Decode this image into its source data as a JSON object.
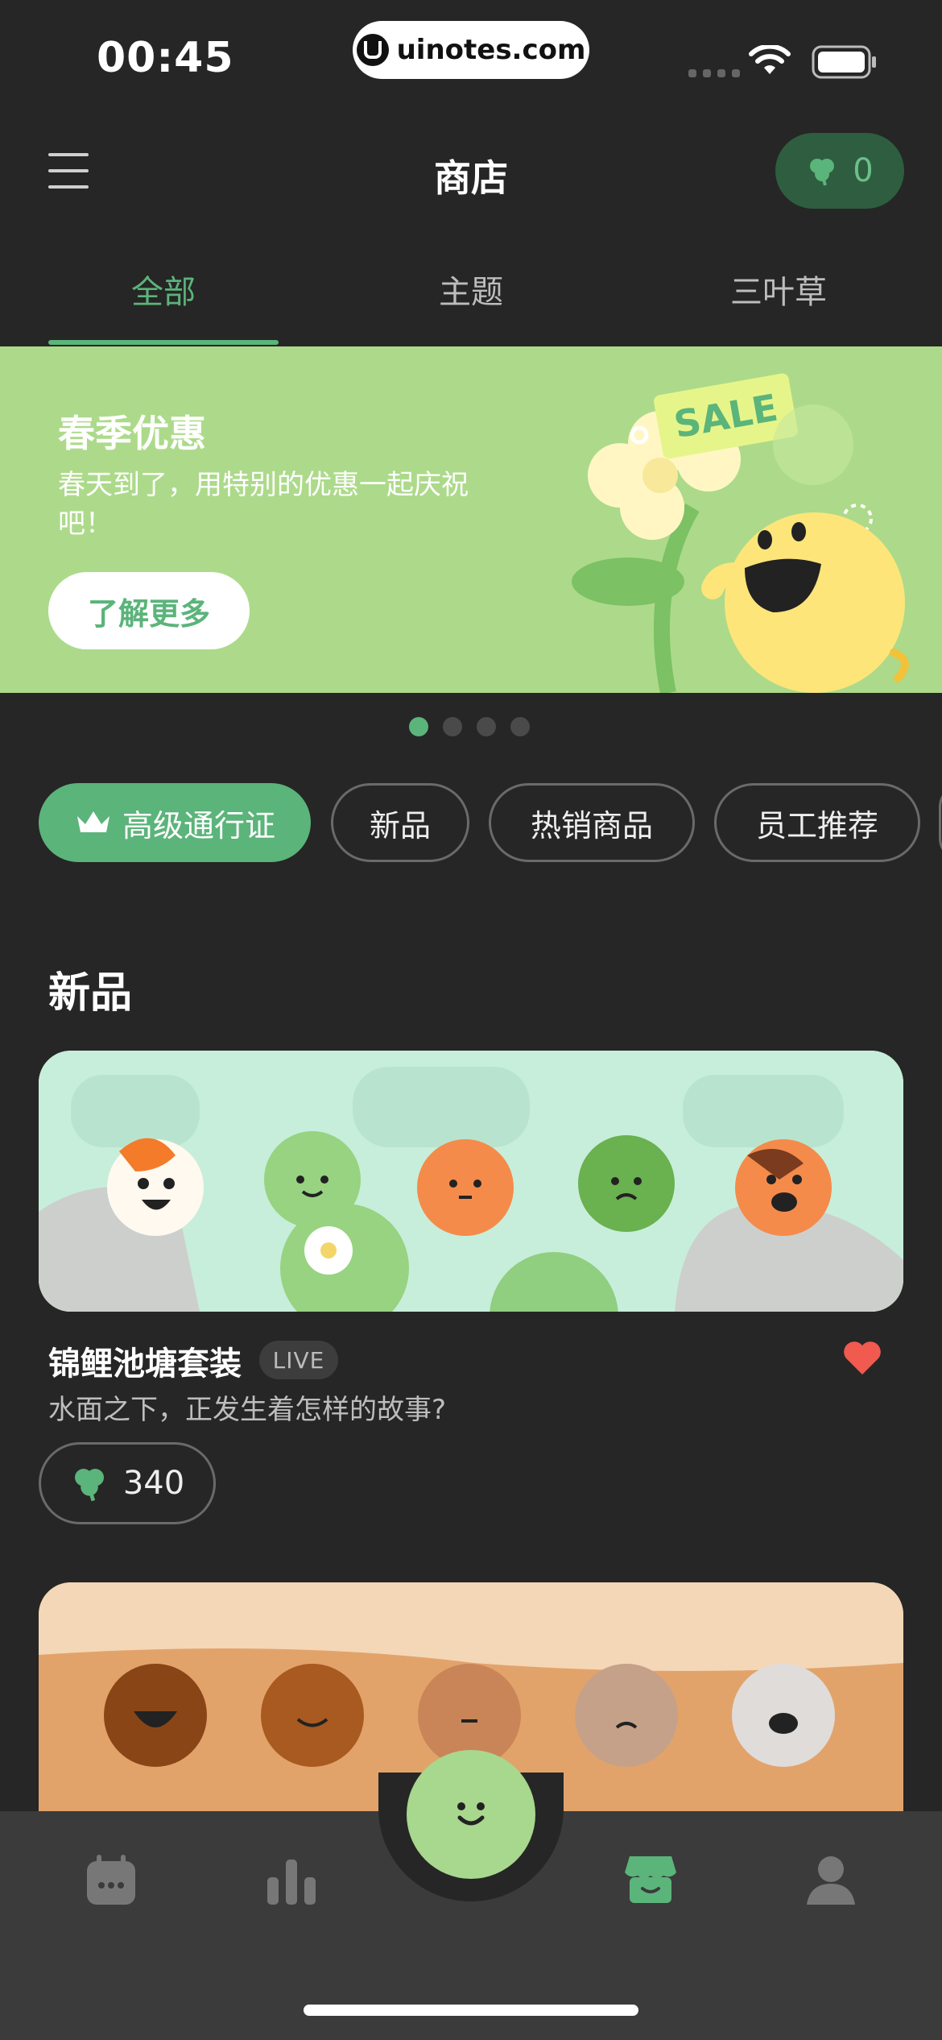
{
  "status": {
    "time": "00:45",
    "url": "uinotes.com"
  },
  "header": {
    "title": "商店",
    "clover_count": "0"
  },
  "tabs": [
    {
      "label": "全部"
    },
    {
      "label": "主题"
    },
    {
      "label": "三叶草"
    }
  ],
  "banner": {
    "title": "春季优惠",
    "subtitle": "春天到了，用特别的优惠一起庆祝吧！",
    "button": "了解更多",
    "sale_tag": "SALE",
    "current_slide": 1,
    "total_slides": 4
  },
  "filters": [
    {
      "label": "高级通行证",
      "icon": "crown-icon"
    },
    {
      "label": "新品"
    },
    {
      "label": "热销商品"
    },
    {
      "label": "员工推荐"
    }
  ],
  "section": {
    "title": "新品"
  },
  "products": [
    {
      "name": "锦鲤池塘套装",
      "badge": "LIVE",
      "description": "水面之下，正发生着怎样的故事?",
      "price": "340",
      "favorited": true
    },
    {
      "name": "",
      "description": ""
    }
  ],
  "colors": {
    "accent": "#5bb47a",
    "background": "#262626",
    "banner": "#acda8a",
    "heart": "#f05a4f"
  },
  "nav": [
    {
      "icon": "calendar-icon"
    },
    {
      "icon": "chart-icon"
    },
    {
      "icon": "mood-face-icon"
    },
    {
      "icon": "store-icon",
      "active": true
    },
    {
      "icon": "profile-icon"
    }
  ]
}
